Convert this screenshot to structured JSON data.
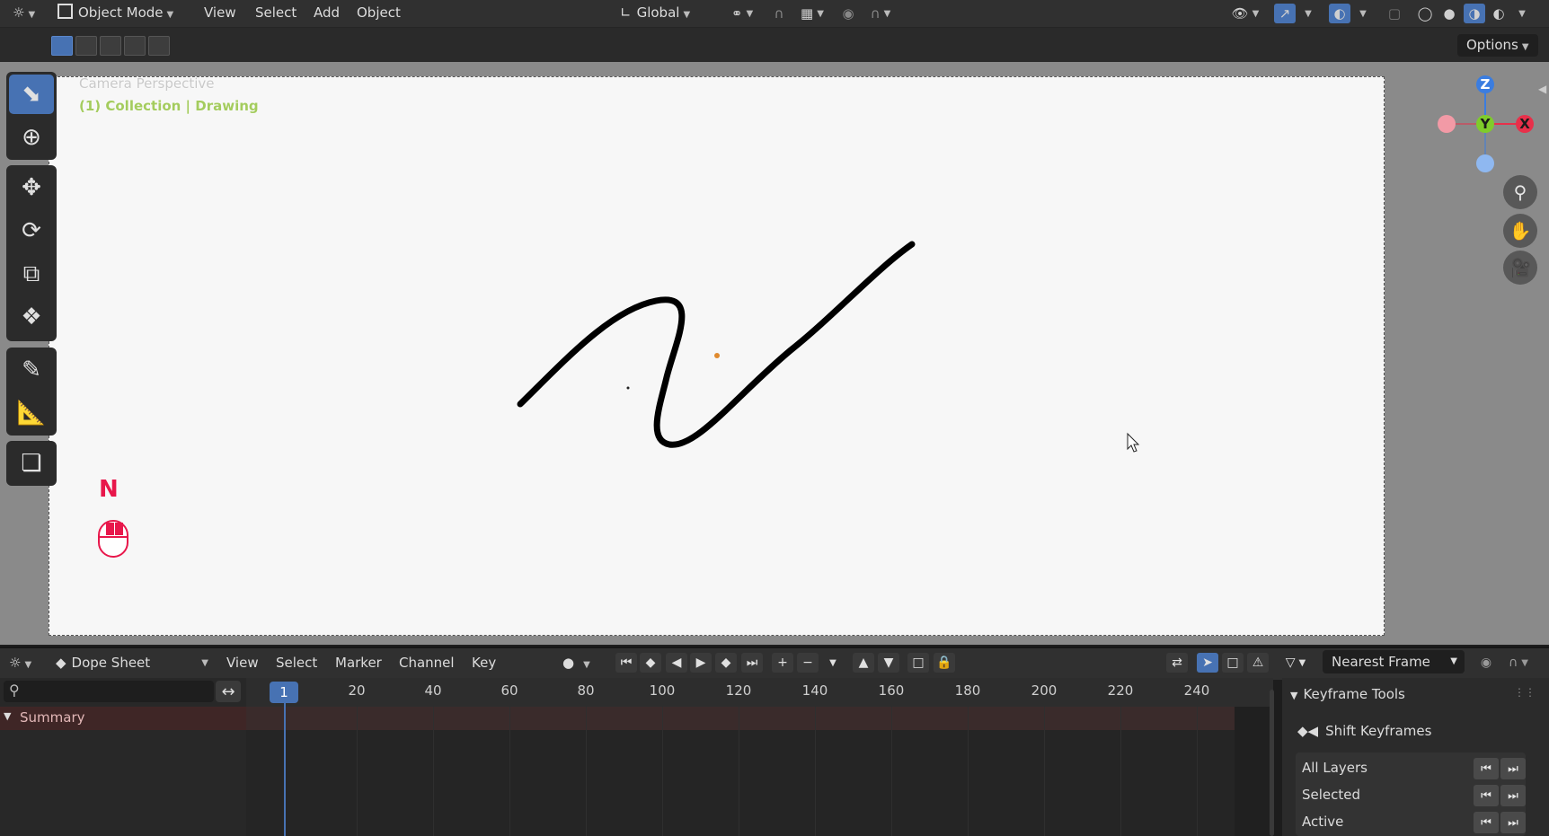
{
  "header": {
    "editor_icon": "editor-type-icon",
    "mode": "Object Mode",
    "menus": [
      "View",
      "Select",
      "Add",
      "Object"
    ],
    "transform_orientation": "Global"
  },
  "tool_settings": {
    "options_label": "Options"
  },
  "viewport": {
    "title": "Camera Perspective",
    "collection_info": "(1) Collection | Drawing",
    "key_hint": "N",
    "gizmo": {
      "z": "Z",
      "y": "Y",
      "x": "X"
    },
    "accent_color": "#4772b3"
  },
  "toolbar": {
    "tools": [
      "select-box",
      "cursor",
      "move",
      "rotate",
      "scale",
      "transform",
      "annotate",
      "measure",
      "add-cube"
    ]
  },
  "dopesheet": {
    "editor_type": "Dope Sheet",
    "menus": [
      "View",
      "Select",
      "Marker",
      "Channel",
      "Key"
    ],
    "snapping": "Nearest Frame",
    "current_frame": "1",
    "ticks": [
      "20",
      "40",
      "60",
      "80",
      "100",
      "120",
      "140",
      "160",
      "180",
      "200",
      "220",
      "240"
    ],
    "summary_label": "Summary",
    "panel": {
      "title": "Keyframe Tools",
      "shift_label": "Shift Keyframes",
      "rows": [
        "All Layers",
        "Selected",
        "Active"
      ]
    }
  }
}
